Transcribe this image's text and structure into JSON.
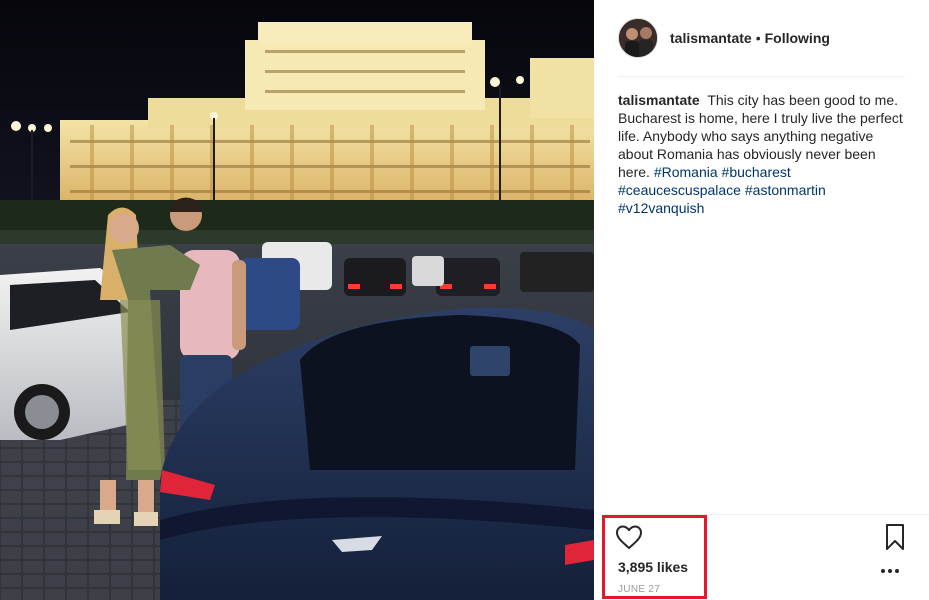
{
  "post": {
    "author": {
      "username": "talismantate",
      "separator": "•",
      "follow_status": "Following"
    },
    "caption": {
      "username": "talismantate",
      "text": "This city has been good to me. Bucharest is home, here I truly live the perfect life. Anybody who says anything negative about Romania has obviously never been here.",
      "hashtags": [
        "#Romania",
        "#bucharest",
        "#ceaucescuspalace",
        "#astonmartin",
        "#v12vanquish"
      ]
    },
    "actions": {
      "like_icon": "heart-icon",
      "save_icon": "bookmark-icon",
      "more_icon": "more-options-icon"
    },
    "likes": "3,895 likes",
    "date": "JUNE 27"
  },
  "colors": {
    "hashtag": "#003569",
    "highlight_box": "#e3182d",
    "secondary_text": "#999999"
  }
}
